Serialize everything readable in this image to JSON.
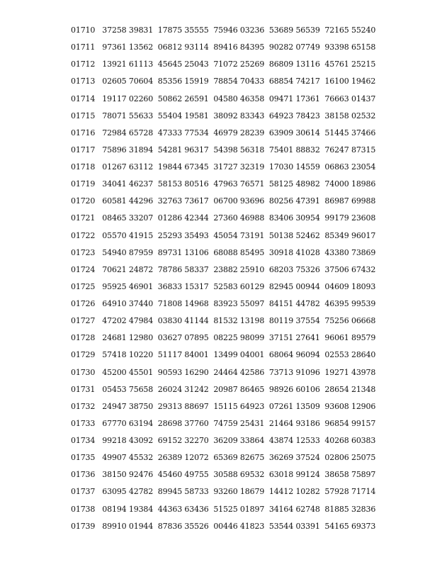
{
  "rows": [
    "01710   37258 39831  17875 35555  75946 03236  53689 56539  72165 55240",
    "01711   97361 13562  06812 93114  89416 84395  90282 07749  93398 65158",
    "01712   13921 61113  45645 25043  71072 25269  86809 13116  45761 25215",
    "01713   02605 70604  85356 15919  78854 70433  68854 74217  16100 19462",
    "01714   19117 02260  50862 26591  04580 46358  09471 17361  76663 01437",
    "01715   78071 55633  55404 19581  38092 83343  64923 78423  38158 02532",
    "01716   72984 65728  47333 77534  46979 28239  63909 30614  51445 37466",
    "01717   75896 31894  54281 96317  54398 56318  75401 88832  76247 87315",
    "01718   01267 63112  19844 67345  31727 32319  17030 14559  06863 23054",
    "01719   34041 46237  58153 80516  47963 76571  58125 48982  74000 18986",
    "01720   60581 44296  32763 73617  06700 93696  80256 47391  86987 69988",
    "01721   08465 33207  01286 42344  27360 46988  83406 30954  99179 23608",
    "01722   05570 41915  25293 35493  45054 73191  50138 52462  85349 96017",
    "01723   54940 87959  89731 13106  68088 85495  30918 41028  43380 73869",
    "01724   70621 24872  78786 58337  23882 25910  68203 75326  37506 67432",
    "01725   95925 46901  36833 15317  52583 60129  82945 00944  04609 18093",
    "01726   64910 37440  71808 14968  83923 55097  84151 44782  46395 99539",
    "01727   47202 47984  03830 41144  81532 13198  80119 37554  75256 06668",
    "01728   24681 12980  03627 07895  08225 98099  37151 27641  96061 89579",
    "01729   57418 10220  51117 84001  13499 04001  68064 96094  02553 28640",
    "01730   45200 45501  90593 16290  24464 42586  73713 91096  19271 43978",
    "01731   05453 75658  26024 31242  20987 86465  98926 60106  28654 21348",
    "01732   24947 38750  29313 88697  15115 64923  07261 13509  93608 12906",
    "01733   67770 63194  28698 37760  74759 25431  21464 93186  96854 99157",
    "01734   99218 43092  69152 32270  36209 33864  43874 12533  40268 60383",
    "01735   49907 45532  26389 12072  65369 82675  36269 37524  02806 25075",
    "01736   38150 92476  45460 49755  30588 69532  63018 99124  38658 75897",
    "01737   63095 42782  89945 58733  93260 18679  14412 10282  57928 71714",
    "01738   08194 19384  44363 63436  51525 01897  34164 62748  81885 32836",
    "01739   89910 01944  87836 35526  00446 41823  53544 03391  54165 69373"
  ]
}
